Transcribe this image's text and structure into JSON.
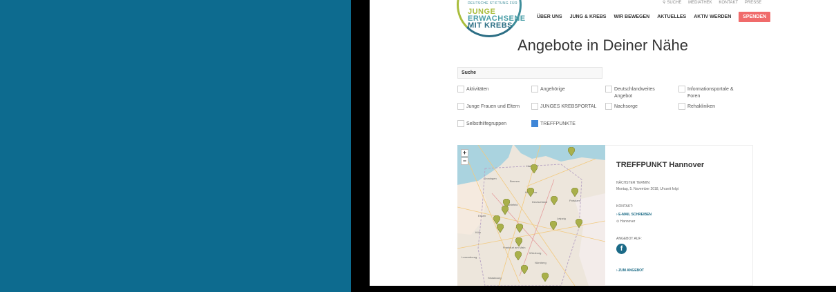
{
  "logo": {
    "top_text": "DEUTSCHE STIFTUNG FÜR",
    "line1": "JUNGE",
    "line2": "ERWACHSENE",
    "line3": "MIT KREBS"
  },
  "top_links": {
    "search": "SUCHE",
    "mediathek": "MEDIATHEK",
    "kontakt": "KONTAKT",
    "presse": "PRESSE"
  },
  "main_nav": [
    "ÜBER UNS",
    "JUNG & KREBS",
    "WIR BEWEGEN",
    "AKTUELLES",
    "AKTIV WERDEN"
  ],
  "spenden_label": "SPENDEN",
  "page_title": "Angebote in Deiner Nähe",
  "search_label": "Suche",
  "filters": [
    {
      "label": "Aktivitäten",
      "checked": false
    },
    {
      "label": "Angehörige",
      "checked": false
    },
    {
      "label": "Deutschlandweites Angebot",
      "checked": false
    },
    {
      "label": "Informationsportale & Foren",
      "checked": false
    },
    {
      "label": "Junge Frauen und Eltern",
      "checked": false
    },
    {
      "label": "JUNGES KREBSPORTAL",
      "checked": false
    },
    {
      "label": "Nachsorge",
      "checked": false
    },
    {
      "label": "Rehakliniken",
      "checked": false
    },
    {
      "label": "Selbsthilfegruppen",
      "checked": false
    },
    {
      "label": "TREFFPUNKTE",
      "checked": true
    }
  ],
  "map": {
    "zoom_in": "+",
    "zoom_out": "−",
    "labels": [
      "Hamburg",
      "Bremen",
      "Groningen",
      "Hannover",
      "Deutschland",
      "Potsdam",
      "Leipzig",
      "Frankfurt am Main",
      "Nürnberg",
      "Strasbourg",
      "Luxembourg",
      "Würzburg",
      "Bielefeld",
      "Essen",
      "Köln"
    ],
    "marker_color": "#a9b04a"
  },
  "detail": {
    "title": "TREFFPUNKT Hannover",
    "next_label": "NÄCHSTER TERMIN:",
    "next_value": "Montag, 5. November 2018, Uhrzeit folgt",
    "contact_label": "KONTAKT:",
    "email_link": "E-MAIL SCHREIBEN",
    "location": "Hannover",
    "offer_label": "ANGEBOT AUF:",
    "facebook_letter": "f",
    "more_link": "ZUM ANGEBOT"
  },
  "colors": {
    "background": "#0d6b8f",
    "accent": "#1a6a85",
    "spenden": "#f06b6b",
    "checkbox_on": "#3f86d7"
  }
}
